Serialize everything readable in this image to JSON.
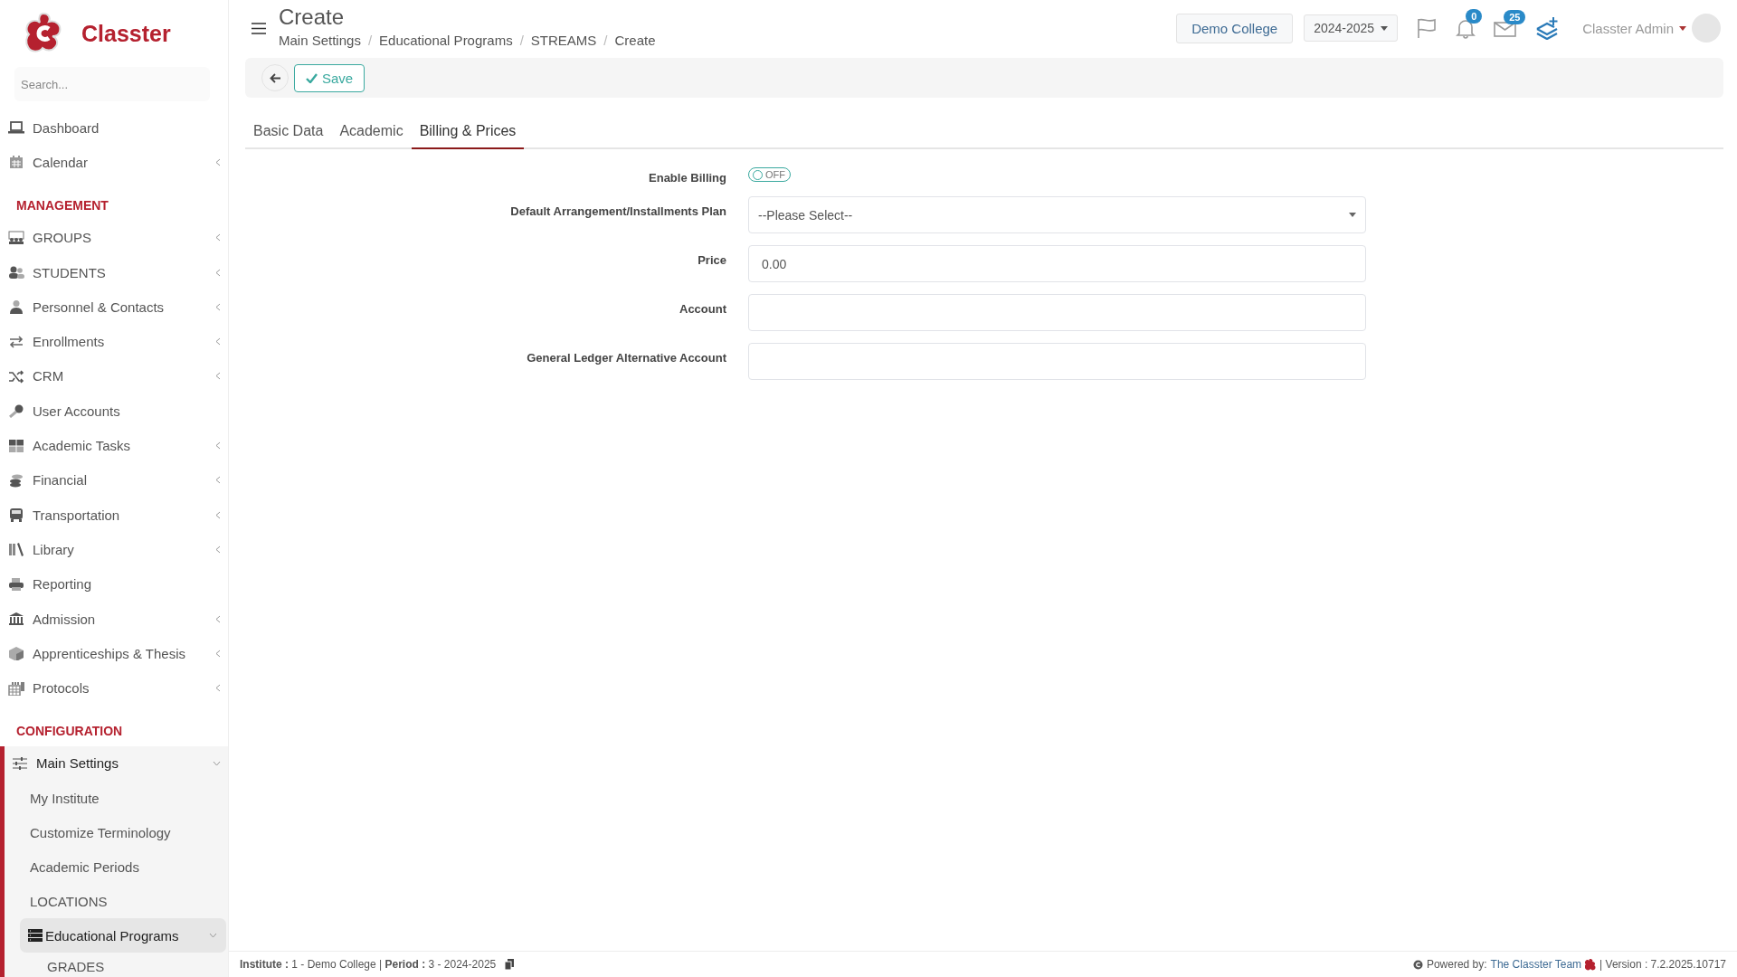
{
  "brand": {
    "name": "Classter"
  },
  "sidebar": {
    "search": {
      "placeholder": "Search..."
    },
    "items": [
      {
        "label": "Dashboard"
      },
      {
        "label": "Calendar",
        "expanded": false
      }
    ],
    "sections": [
      {
        "title": "MANAGEMENT",
        "items": [
          {
            "label": "GROUPS",
            "expanded": false
          },
          {
            "label": "STUDENTS",
            "expanded": false
          },
          {
            "label": "Personnel & Contacts",
            "expanded": false
          },
          {
            "label": "Enrollments",
            "expanded": false
          },
          {
            "label": "CRM",
            "expanded": false
          },
          {
            "label": "User Accounts"
          },
          {
            "label": "Academic Tasks",
            "expanded": false
          },
          {
            "label": "Financial",
            "expanded": false
          },
          {
            "label": "Transportation",
            "expanded": false
          },
          {
            "label": "Library",
            "expanded": false
          },
          {
            "label": "Reporting"
          },
          {
            "label": "Admission",
            "expanded": false
          },
          {
            "label": "Apprenticeships & Thesis",
            "expanded": false
          },
          {
            "label": "Protocols",
            "expanded": false
          }
        ]
      },
      {
        "title": "CONFIGURATION",
        "items": [
          {
            "label": "Main Settings",
            "expanded": true,
            "children": [
              {
                "label": "My Institute",
                "selected": false
              },
              {
                "label": "Customize Terminology",
                "selected": false
              },
              {
                "label": "Academic Periods",
                "selected": false
              },
              {
                "label": "LOCATIONS",
                "selected": false
              },
              {
                "label": "Educational Programs",
                "selected": true,
                "expanded": true,
                "children": [
                  {
                    "label": "GRADES",
                    "selected": false
                  }
                ]
              }
            ]
          }
        ]
      }
    ]
  },
  "header": {
    "title": "Create",
    "breadcrumb": [
      "Main Settings",
      "Educational Programs",
      "STREAMS",
      "Create"
    ],
    "breadcrumb_separator": "/",
    "institute": "Demo College",
    "period": "2024-2025",
    "notifications": "0",
    "messages": "25",
    "user": "Classter Admin"
  },
  "toolbar": {
    "save": "Save"
  },
  "tabs": [
    {
      "label": "Basic Data",
      "selected": false
    },
    {
      "label": "Academic",
      "selected": false
    },
    {
      "label": "Billing & Prices",
      "selected": true
    }
  ],
  "form": {
    "fields": [
      {
        "kind": "toggle",
        "label": "Enable Billing",
        "on": false,
        "text": "OFF"
      },
      {
        "kind": "select",
        "label": "Default Arrangement/Installments Plan",
        "value": "--Please Select--"
      },
      {
        "kind": "input",
        "label": "Price",
        "value": "0.00"
      },
      {
        "kind": "input",
        "label": "Account"
      },
      {
        "kind": "input",
        "label": "General Ledger Alternative Account"
      }
    ]
  },
  "footer": {
    "info": "**Institute :** 1 - Demo College | **Period :** 3 - 2024-2025",
    "powered": "Powered by:",
    "team": "The Classter Team",
    "version": "| Version : 7.2.2025.10717"
  }
}
